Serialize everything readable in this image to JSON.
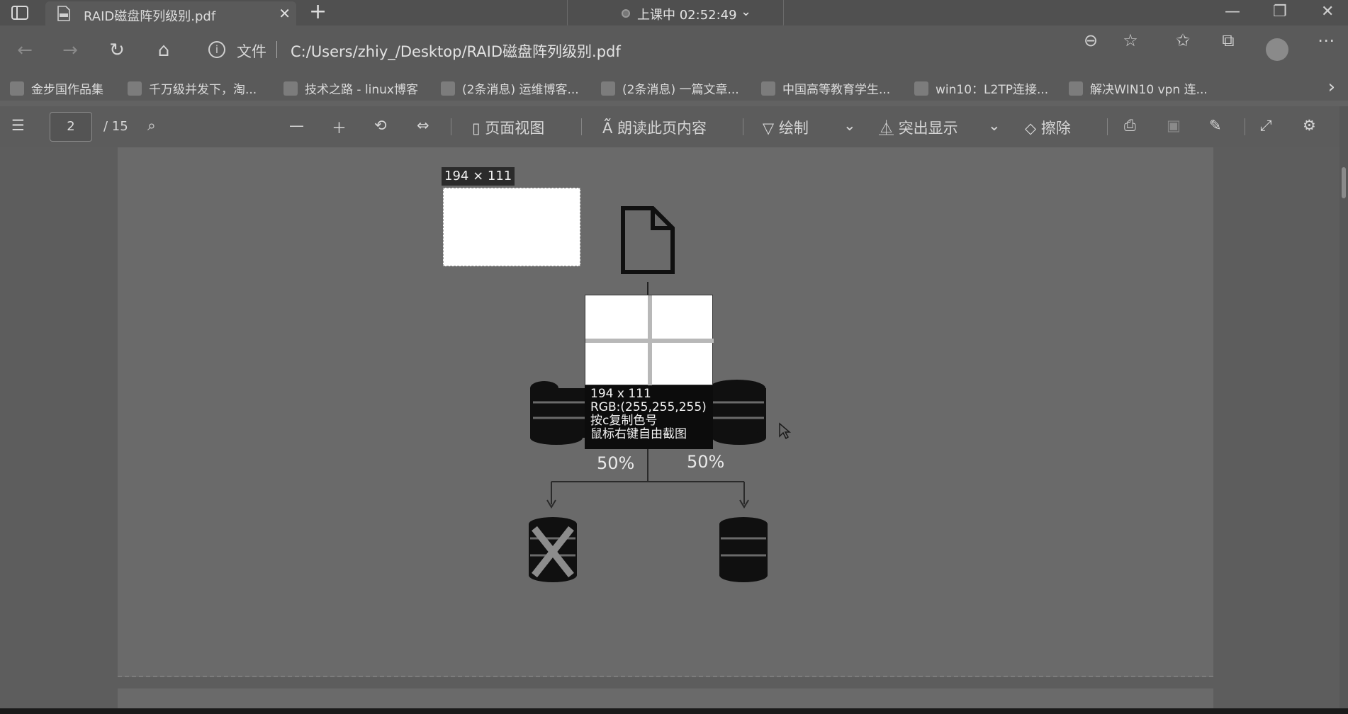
{
  "tab": {
    "title": "RAID磁盘阵列级别.pdf",
    "close": "✕",
    "new_tab": "+"
  },
  "recording": {
    "text": "上课中 02:52:49",
    "chevron": "⌄"
  },
  "window_controls": {
    "minimize": "—",
    "restore": "❐",
    "close": "✕"
  },
  "address": {
    "site_label": "文件",
    "url": "C:/Users/zhiy_/Desktop/RAID磁盘阵列级别.pdf"
  },
  "bookmarks": [
    "金步国作品集",
    "千万级并发下，淘...",
    "技术之路 - linux博客",
    "(2条消息) 运维博客...",
    "(2条消息) 一篇文章...",
    "中国高等教育学生...",
    "win10：L2TP连接...",
    "解决WIN10 vpn 连..."
  ],
  "pdf_toolbar": {
    "page_current": "2",
    "page_total": "/ 15",
    "page_view": "页面视图",
    "read_aloud": "朗读此页内容",
    "draw": "绘制",
    "highlight": "突出显示",
    "erase": "擦除"
  },
  "diagram": {
    "left_pct": "50%",
    "right_pct": "50%"
  },
  "screenshot_tool": {
    "size_badge": "194 × 111",
    "info_size": "194 x 111",
    "info_rgb": "RGB:(255,255,255)",
    "info_copy_hint": "按c复制色号",
    "info_capture_hint": "鼠标右键自由截图"
  },
  "colors": {
    "background_dim": "#626262",
    "selection": "#ffffff",
    "infobox": "#0c0c0c"
  }
}
